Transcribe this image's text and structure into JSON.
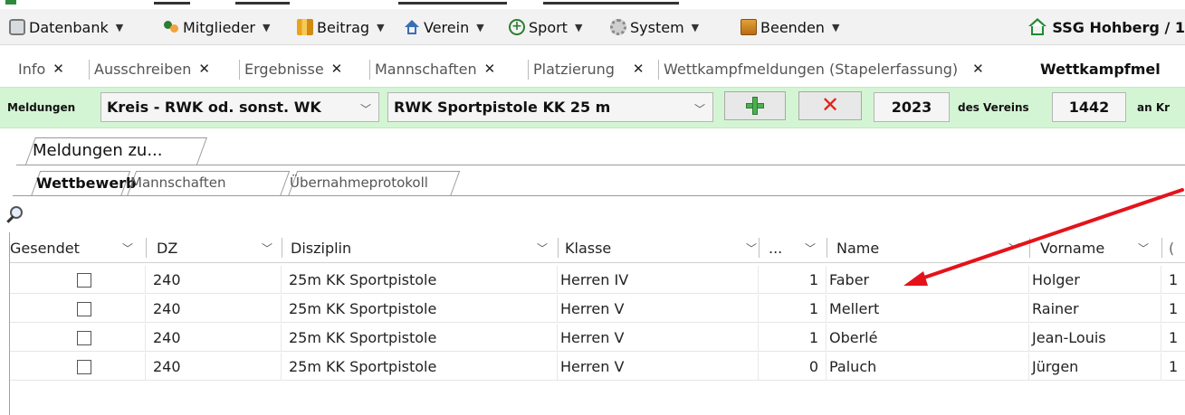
{
  "menubar": {
    "items": [
      {
        "label": "Datenbank",
        "icon": "database-icon"
      },
      {
        "label": "Mitglieder",
        "icon": "members-icon"
      },
      {
        "label": "Beitrag",
        "icon": "coins-icon"
      },
      {
        "label": "Verein",
        "icon": "house-icon"
      },
      {
        "label": "Sport",
        "icon": "plus-circle-icon"
      },
      {
        "label": "System",
        "icon": "gear-icon"
      },
      {
        "label": "Beenden",
        "icon": "exit-icon"
      }
    ],
    "club_name": "SSG Hohberg / 1"
  },
  "tabs": [
    {
      "label": "Info"
    },
    {
      "label": "Ausschreiben"
    },
    {
      "label": "Ergebnisse"
    },
    {
      "label": "Mannschaften"
    },
    {
      "label": "Platzierung"
    },
    {
      "label": "Wettkampfmeldungen (Stapelerfassung)"
    },
    {
      "label": "Wettkampfmel"
    }
  ],
  "toolbar": {
    "label_meldungen": "Meldungen",
    "level_select": "Kreis - RWK od. sonst. WK",
    "competition_select": "RWK Sportpistole KK 25 m",
    "year": "2023",
    "label_des_vereins": "des Vereins",
    "club_number": "1442",
    "label_an": "an Kr"
  },
  "panel": {
    "title": "Meldungen zu...",
    "subtabs": [
      "Wettbewerb",
      "Mannschaften",
      "Übernahmeprotokoll"
    ]
  },
  "grid": {
    "columns": [
      "Gesendet",
      "DZ",
      "Disziplin",
      "Klasse",
      "...",
      "Name",
      "Vorname",
      "("
    ],
    "rows": [
      {
        "dz": "240",
        "disziplin": "25m KK Sportpistole",
        "klasse": "Herren IV",
        "num": "1",
        "name": "Faber",
        "vorname": "Holger",
        "extra": "1"
      },
      {
        "dz": "240",
        "disziplin": "25m KK Sportpistole",
        "klasse": "Herren V",
        "num": "1",
        "name": "Mellert",
        "vorname": "Rainer",
        "extra": "1"
      },
      {
        "dz": "240",
        "disziplin": "25m KK Sportpistole",
        "klasse": "Herren V",
        "num": "1",
        "name": "Oberlé",
        "vorname": "Jean-Louis",
        "extra": "1"
      },
      {
        "dz": "240",
        "disziplin": "25m KK Sportpistole",
        "klasse": "Herren V",
        "num": "0",
        "name": "Paluch",
        "vorname": "Jürgen",
        "extra": "1"
      }
    ]
  },
  "colors": {
    "toolbar_bg": "#d4f5d4",
    "annotation_arrow": "#e4131a",
    "accent_green": "#1f8a2e",
    "delete_red": "#e2231a"
  }
}
